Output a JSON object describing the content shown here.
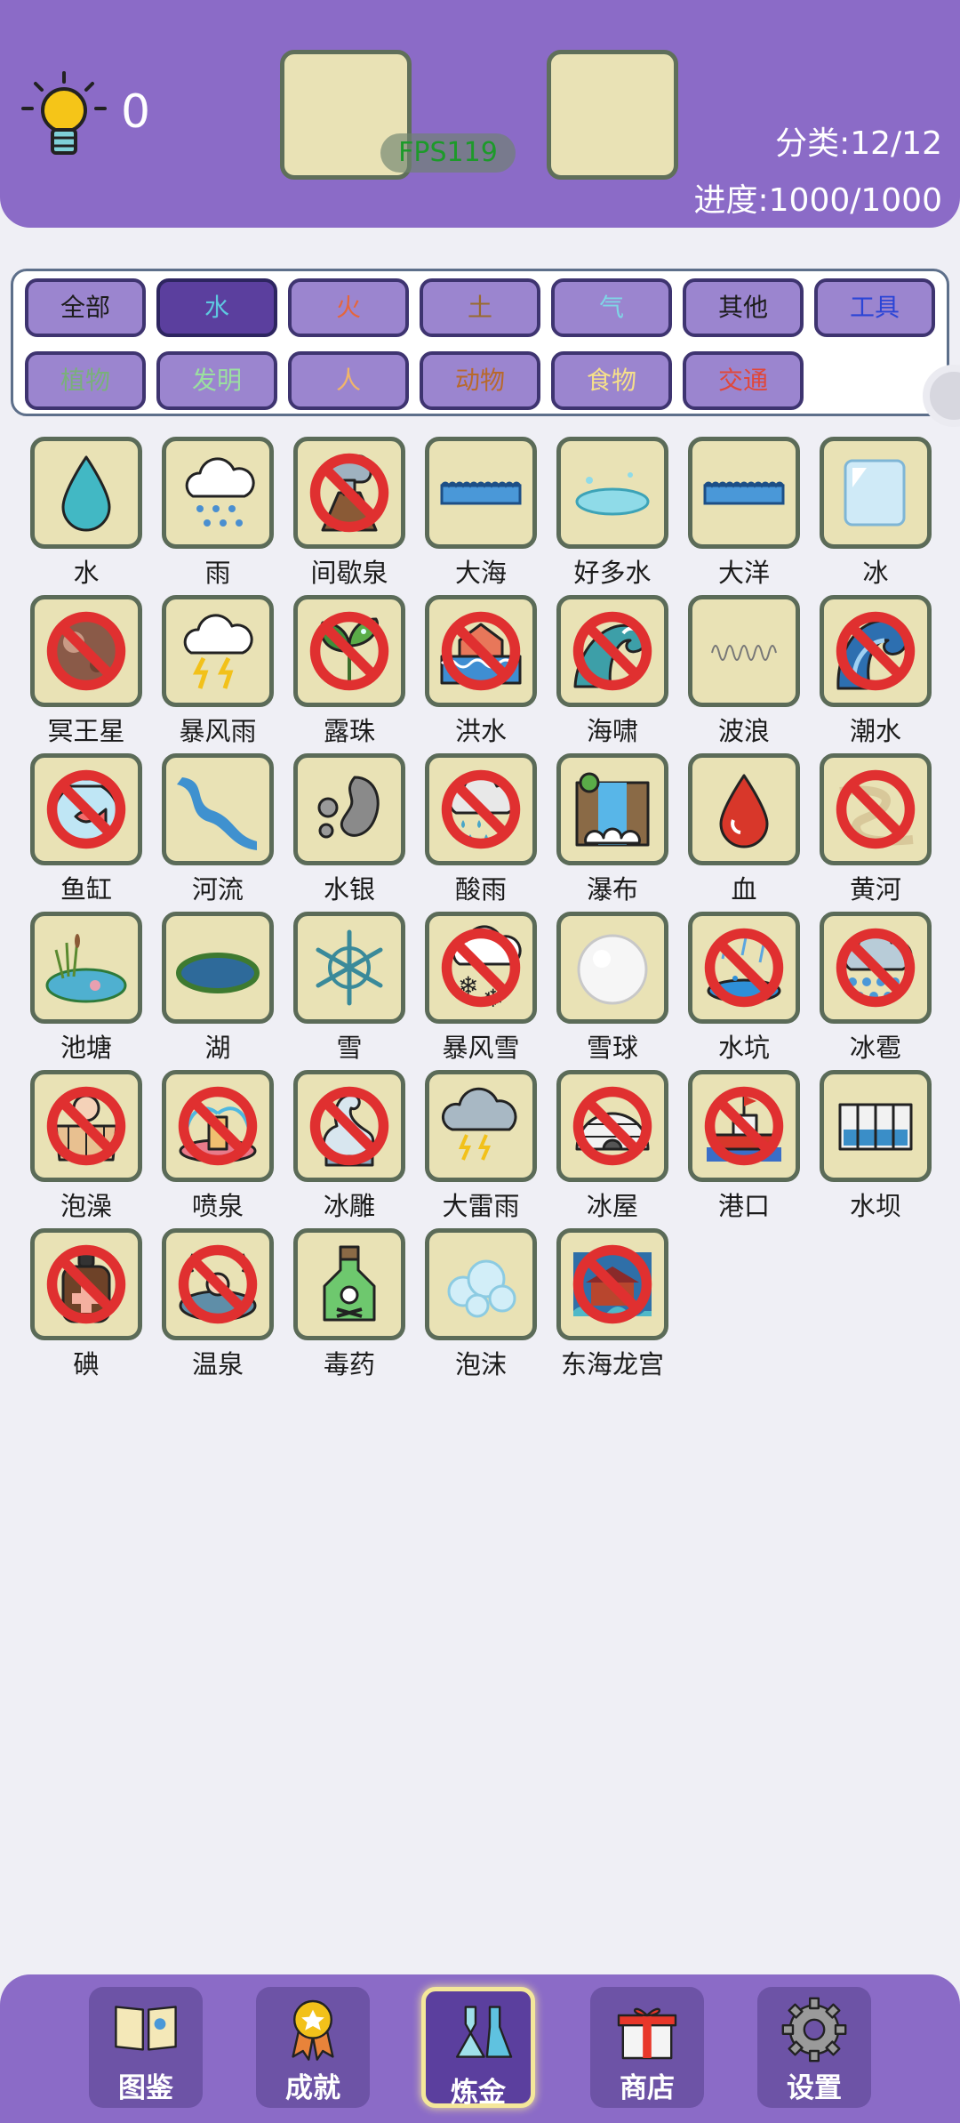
{
  "header": {
    "hint_count": "0",
    "fps": "FPS119",
    "category_stat": "分类:12/12",
    "progress_stat": "进度:1000/1000"
  },
  "categories": [
    {
      "label": "全部",
      "color": "#1c1c1c",
      "active": false
    },
    {
      "label": "水",
      "color": "#5ec8e0",
      "active": true
    },
    {
      "label": "火",
      "color": "#e5663c",
      "active": false
    },
    {
      "label": "土",
      "color": "#9a6a2e",
      "active": false
    },
    {
      "label": "气",
      "color": "#7fd6e6",
      "active": false
    },
    {
      "label": "其他",
      "color": "#1c1c1c",
      "active": false
    },
    {
      "label": "工具",
      "color": "#2b45d6",
      "active": false
    },
    {
      "label": "植物",
      "color": "#7ab07a",
      "active": false
    },
    {
      "label": "发明",
      "color": "#9be0a0",
      "active": false
    },
    {
      "label": "人",
      "color": "#f0b56a",
      "active": false
    },
    {
      "label": "动物",
      "color": "#b8692c",
      "active": false
    },
    {
      "label": "食物",
      "color": "#f6e08a",
      "active": false
    },
    {
      "label": "交通",
      "color": "#e0473a",
      "active": false
    }
  ],
  "elements": [
    {
      "label": "水",
      "icon": "water-drop-icon",
      "banned": false
    },
    {
      "label": "雨",
      "icon": "rain-cloud-icon",
      "banned": false
    },
    {
      "label": "间歇泉",
      "icon": "geyser-icon",
      "banned": true
    },
    {
      "label": "大海",
      "icon": "sea-waves-icon",
      "banned": false
    },
    {
      "label": "好多水",
      "icon": "puddle-icon",
      "banned": false
    },
    {
      "label": "大洋",
      "icon": "ocean-waves-icon",
      "banned": false
    },
    {
      "label": "冰",
      "icon": "ice-cube-icon",
      "banned": false
    },
    {
      "label": "冥王星",
      "icon": "pluto-planet-icon",
      "banned": true
    },
    {
      "label": "暴风雨",
      "icon": "thunderstorm-icon",
      "banned": false
    },
    {
      "label": "露珠",
      "icon": "dew-leaf-icon",
      "banned": true
    },
    {
      "label": "洪水",
      "icon": "flood-house-icon",
      "banned": true
    },
    {
      "label": "海啸",
      "icon": "tsunami-icon",
      "banned": true
    },
    {
      "label": "波浪",
      "icon": "wave-line-icon",
      "banned": false
    },
    {
      "label": "潮水",
      "icon": "tide-wave-icon",
      "banned": true
    },
    {
      "label": "鱼缸",
      "icon": "fishbowl-icon",
      "banned": true
    },
    {
      "label": "河流",
      "icon": "river-icon",
      "banned": false
    },
    {
      "label": "水银",
      "icon": "mercury-icon",
      "banned": false
    },
    {
      "label": "酸雨",
      "icon": "acid-rain-icon",
      "banned": true
    },
    {
      "label": "瀑布",
      "icon": "waterfall-icon",
      "banned": false
    },
    {
      "label": "血",
      "icon": "blood-drop-icon",
      "banned": false
    },
    {
      "label": "黄河",
      "icon": "yellow-river-icon",
      "banned": true
    },
    {
      "label": "池塘",
      "icon": "pond-icon",
      "banned": false
    },
    {
      "label": "湖",
      "icon": "lake-icon",
      "banned": false
    },
    {
      "label": "雪",
      "icon": "snowflake-icon",
      "banned": false
    },
    {
      "label": "暴风雪",
      "icon": "blizzard-icon",
      "banned": true
    },
    {
      "label": "雪球",
      "icon": "snowball-icon",
      "banned": false
    },
    {
      "label": "水坑",
      "icon": "rain-puddle-icon",
      "banned": true
    },
    {
      "label": "冰雹",
      "icon": "hail-icon",
      "banned": true
    },
    {
      "label": "泡澡",
      "icon": "bath-tub-icon",
      "banned": true
    },
    {
      "label": "喷泉",
      "icon": "fountain-icon",
      "banned": true
    },
    {
      "label": "冰雕",
      "icon": "ice-swan-icon",
      "banned": true
    },
    {
      "label": "大雷雨",
      "icon": "heavy-thunderstorm-icon",
      "banned": false
    },
    {
      "label": "冰屋",
      "icon": "igloo-icon",
      "banned": true
    },
    {
      "label": "港口",
      "icon": "harbor-ship-icon",
      "banned": true
    },
    {
      "label": "水坝",
      "icon": "dam-icon",
      "banned": false
    },
    {
      "label": "碘",
      "icon": "iodine-bottle-icon",
      "banned": true
    },
    {
      "label": "温泉",
      "icon": "hot-spring-icon",
      "banned": true
    },
    {
      "label": "毒药",
      "icon": "poison-bottle-icon",
      "banned": false
    },
    {
      "label": "泡沫",
      "icon": "foam-bubbles-icon",
      "banned": false
    },
    {
      "label": "东海龙宫",
      "icon": "dragon-palace-icon",
      "banned": true
    }
  ],
  "nav": [
    {
      "label": "图鉴",
      "icon": "book-icon",
      "active": false
    },
    {
      "label": "成就",
      "icon": "medal-icon",
      "active": false
    },
    {
      "label": "炼金",
      "icon": "flask-icon",
      "active": true
    },
    {
      "label": "商店",
      "icon": "gift-icon",
      "active": false
    },
    {
      "label": "设置",
      "icon": "gear-icon",
      "active": false
    }
  ]
}
